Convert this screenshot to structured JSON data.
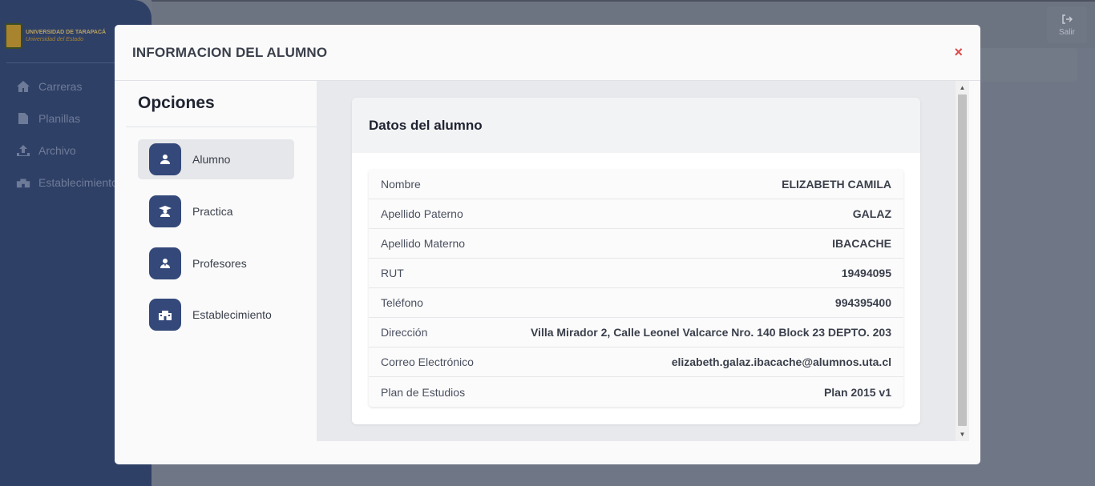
{
  "app": {
    "brand_line1": "UNIVERSIDAD DE TARAPACÁ",
    "brand_line2": "Universidad del Estado",
    "nav": [
      {
        "label": "Carreras",
        "icon": "home-icon"
      },
      {
        "label": "Planillas",
        "icon": "document-icon"
      },
      {
        "label": "Archivo",
        "icon": "upload-icon"
      },
      {
        "label": "Establecimiento",
        "icon": "building-icon"
      }
    ],
    "logout_label": "Salir"
  },
  "modal": {
    "title": "INFORMACION DEL ALUMNO",
    "close_symbol": "×",
    "options_title": "Opciones",
    "options": [
      {
        "label": "Alumno",
        "icon": "user-icon",
        "active": true
      },
      {
        "label": "Practica",
        "icon": "graduate-icon",
        "active": false
      },
      {
        "label": "Profesores",
        "icon": "teacher-icon",
        "active": false
      },
      {
        "label": "Establecimiento",
        "icon": "school-icon",
        "active": false
      }
    ],
    "card_title": "Datos del alumno",
    "fields": [
      {
        "label": "Nombre",
        "value": "ELIZABETH CAMILA"
      },
      {
        "label": "Apellido Paterno",
        "value": "GALAZ"
      },
      {
        "label": "Apellido Materno",
        "value": "IBACACHE"
      },
      {
        "label": "RUT",
        "value": "19494095"
      },
      {
        "label": "Teléfono",
        "value": "994395400"
      },
      {
        "label": "Dirección",
        "value": "Villa Mirador 2, Calle Leonel Valcarce Nro. 140 Block 23 DEPTO. 203"
      },
      {
        "label": "Correo Electrónico",
        "value": "elizabeth.galaz.ibacache@alumnos.uta.cl"
      },
      {
        "label": "Plan de Estudios",
        "value": "Plan 2015 v1"
      }
    ]
  },
  "colors": {
    "sidebar_bg": "#2f4067",
    "accent": "#34497a",
    "close": "#e04848"
  }
}
